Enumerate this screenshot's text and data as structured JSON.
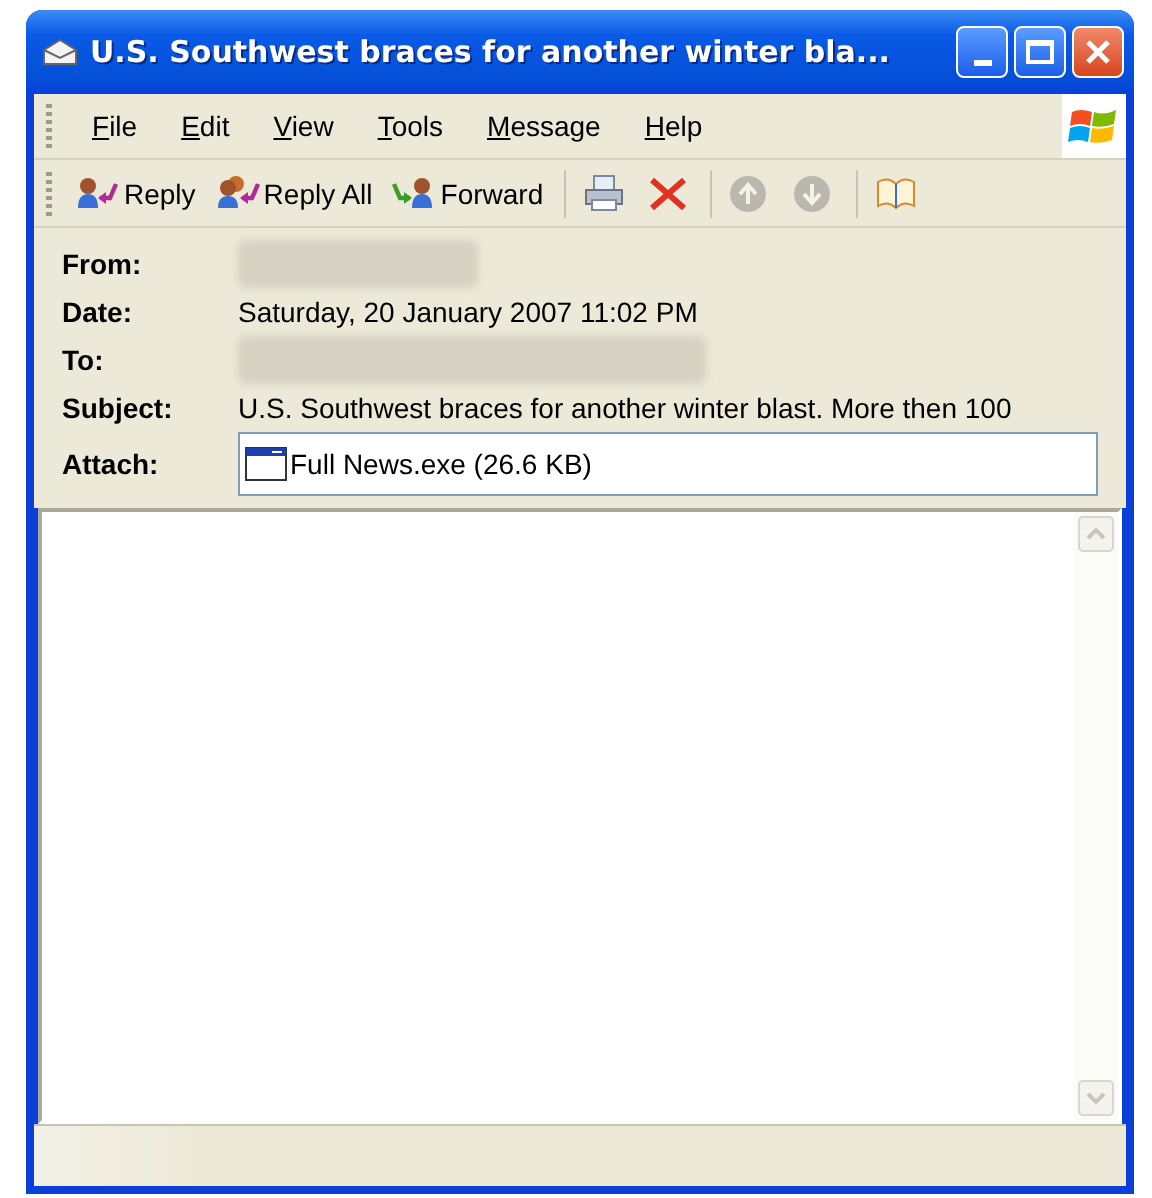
{
  "window": {
    "title": "U.S. Southwest braces for another winter bla..."
  },
  "menu": [
    {
      "label": "File"
    },
    {
      "label": "Edit"
    },
    {
      "label": "View"
    },
    {
      "label": "Tools"
    },
    {
      "label": "Message"
    },
    {
      "label": "Help"
    }
  ],
  "toolbar": [
    [
      {
        "kind": "reply",
        "label": "Reply",
        "disabled": false
      },
      {
        "kind": "reply_all",
        "label": "Reply All",
        "disabled": false
      },
      {
        "kind": "forward",
        "label": "Forward",
        "disabled": false
      }
    ],
    [
      {
        "kind": "print",
        "disabled": false
      },
      {
        "kind": "delete",
        "disabled": false
      }
    ],
    [
      {
        "kind": "previous",
        "disabled": true
      },
      {
        "kind": "next",
        "disabled": true
      }
    ],
    [
      {
        "kind": "addresses",
        "disabled": false
      }
    ]
  ],
  "header": [
    {
      "kind": "blurred",
      "label": "From:"
    },
    {
      "kind": "text",
      "label": "Date:",
      "value": "Saturday, 20 January 2007 11:02 PM"
    },
    {
      "kind": "blurred",
      "label": "To:"
    },
    {
      "kind": "text",
      "label": "Subject:",
      "value": "U.S. Southwest braces for another winter blast. More then 100"
    },
    {
      "kind": "attachment",
      "label": "Attach:",
      "value": "Full News.exe (26.6 KB)"
    }
  ]
}
